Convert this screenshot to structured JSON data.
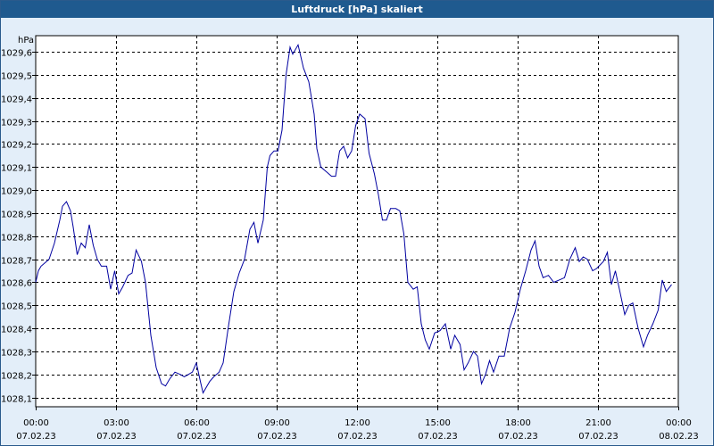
{
  "window": {
    "title": "Luftdruck [hPa] skaliert"
  },
  "colors": {
    "line": "#0000a0",
    "grid": "#000000",
    "plot_bg": "#ffffff",
    "titlebar": "#1f5a8f",
    "background": "#e3eef9"
  },
  "chart_data": {
    "type": "line",
    "title": "Luftdruck [hPa] skaliert",
    "ylabel": "hPa",
    "xlabel": "",
    "ylim": [
      1028.06,
      1029.67
    ],
    "yticks": [
      1028.1,
      1028.2,
      1028.3,
      1028.4,
      1028.5,
      1028.6,
      1028.7,
      1028.8,
      1028.9,
      1029.0,
      1029.1,
      1029.2,
      1029.3,
      1029.4,
      1029.5,
      1029.6
    ],
    "ytick_labels": [
      "1028,1",
      "1028,2",
      "1028,3",
      "1028,4",
      "1028,5",
      "1028,6",
      "1028,7",
      "1028,8",
      "1028,9",
      "1029,0",
      "1029,1",
      "1029,2",
      "1029,3",
      "1029,4",
      "1029,5",
      "1029,6"
    ],
    "xlim_hours": [
      0,
      24
    ],
    "xticks_hours": [
      0,
      3,
      6,
      9,
      12,
      15,
      18,
      21,
      24
    ],
    "xtick_labels": [
      [
        "00:00",
        "07.02.23"
      ],
      [
        "03:00",
        "07.02.23"
      ],
      [
        "06:00",
        "07.02.23"
      ],
      [
        "09:00",
        "07.02.23"
      ],
      [
        "12:00",
        "07.02.23"
      ],
      [
        "15:00",
        "07.02.23"
      ],
      [
        "18:00",
        "07.02.23"
      ],
      [
        "21:00",
        "07.02.23"
      ],
      [
        "00:00",
        "08.02.23"
      ]
    ],
    "grid": true,
    "legend": "none",
    "series": [
      {
        "points": [
          [
            0.0,
            1028.6
          ],
          [
            0.1,
            1028.65
          ],
          [
            0.2,
            1028.67
          ],
          [
            0.4,
            1028.69
          ],
          [
            0.5,
            1028.7
          ],
          [
            0.7,
            1028.77
          ],
          [
            0.9,
            1028.87
          ],
          [
            1.0,
            1028.93
          ],
          [
            1.15,
            1028.95
          ],
          [
            1.3,
            1028.91
          ],
          [
            1.4,
            1028.84
          ],
          [
            1.55,
            1028.72
          ],
          [
            1.7,
            1028.77
          ],
          [
            1.85,
            1028.75
          ],
          [
            2.0,
            1028.85
          ],
          [
            2.15,
            1028.76
          ],
          [
            2.3,
            1028.7
          ],
          [
            2.45,
            1028.67
          ],
          [
            2.65,
            1028.67
          ],
          [
            2.8,
            1028.57
          ],
          [
            2.95,
            1028.65
          ],
          [
            3.1,
            1028.55
          ],
          [
            3.25,
            1028.58
          ],
          [
            3.45,
            1028.63
          ],
          [
            3.6,
            1028.64
          ],
          [
            3.75,
            1028.74
          ],
          [
            3.95,
            1028.69
          ],
          [
            4.1,
            1028.6
          ],
          [
            4.3,
            1028.37
          ],
          [
            4.5,
            1028.23
          ],
          [
            4.7,
            1028.16
          ],
          [
            4.85,
            1028.15
          ],
          [
            5.0,
            1028.18
          ],
          [
            5.2,
            1028.21
          ],
          [
            5.4,
            1028.2
          ],
          [
            5.55,
            1028.19
          ],
          [
            5.7,
            1028.2
          ],
          [
            5.85,
            1028.21
          ],
          [
            6.0,
            1028.25
          ],
          [
            6.15,
            1028.17
          ],
          [
            6.25,
            1028.12
          ],
          [
            6.35,
            1028.14
          ],
          [
            6.5,
            1028.17
          ],
          [
            6.65,
            1028.19
          ],
          [
            6.85,
            1028.21
          ],
          [
            7.0,
            1028.25
          ],
          [
            7.2,
            1028.41
          ],
          [
            7.4,
            1028.56
          ],
          [
            7.6,
            1028.64
          ],
          [
            7.8,
            1028.7
          ],
          [
            8.0,
            1028.83
          ],
          [
            8.15,
            1028.86
          ],
          [
            8.3,
            1028.77
          ],
          [
            8.5,
            1028.87
          ],
          [
            8.65,
            1029.1
          ],
          [
            8.75,
            1029.15
          ],
          [
            8.9,
            1029.17
          ],
          [
            9.05,
            1029.17
          ],
          [
            9.2,
            1029.26
          ],
          [
            9.35,
            1029.5
          ],
          [
            9.5,
            1029.62
          ],
          [
            9.6,
            1029.59
          ],
          [
            9.8,
            1029.63
          ],
          [
            10.0,
            1029.53
          ],
          [
            10.2,
            1029.47
          ],
          [
            10.4,
            1029.33
          ],
          [
            10.5,
            1029.18
          ],
          [
            10.65,
            1029.1
          ],
          [
            10.85,
            1029.08
          ],
          [
            11.05,
            1029.06
          ],
          [
            11.2,
            1029.06
          ],
          [
            11.35,
            1029.17
          ],
          [
            11.5,
            1029.19
          ],
          [
            11.65,
            1029.14
          ],
          [
            11.8,
            1029.17
          ],
          [
            11.95,
            1029.28
          ],
          [
            12.1,
            1029.33
          ],
          [
            12.3,
            1029.31
          ],
          [
            12.45,
            1029.16
          ],
          [
            12.65,
            1029.07
          ],
          [
            12.8,
            1028.98
          ],
          [
            12.95,
            1028.87
          ],
          [
            13.1,
            1028.87
          ],
          [
            13.25,
            1028.92
          ],
          [
            13.45,
            1028.92
          ],
          [
            13.6,
            1028.91
          ],
          [
            13.75,
            1028.81
          ],
          [
            13.9,
            1028.6
          ],
          [
            14.1,
            1028.57
          ],
          [
            14.25,
            1028.58
          ],
          [
            14.4,
            1028.42
          ],
          [
            14.55,
            1028.35
          ],
          [
            14.7,
            1028.31
          ],
          [
            14.9,
            1028.38
          ],
          [
            15.1,
            1028.39
          ],
          [
            15.3,
            1028.42
          ],
          [
            15.5,
            1028.31
          ],
          [
            15.65,
            1028.37
          ],
          [
            15.85,
            1028.33
          ],
          [
            16.0,
            1028.22
          ],
          [
            16.15,
            1028.25
          ],
          [
            16.35,
            1028.3
          ],
          [
            16.5,
            1028.28
          ],
          [
            16.65,
            1028.16
          ],
          [
            16.8,
            1028.2
          ],
          [
            16.95,
            1028.26
          ],
          [
            17.1,
            1028.21
          ],
          [
            17.3,
            1028.28
          ],
          [
            17.5,
            1028.28
          ],
          [
            17.7,
            1028.4
          ],
          [
            17.9,
            1028.47
          ],
          [
            18.1,
            1028.57
          ],
          [
            18.3,
            1028.65
          ],
          [
            18.5,
            1028.74
          ],
          [
            18.65,
            1028.78
          ],
          [
            18.8,
            1028.67
          ],
          [
            18.95,
            1028.62
          ],
          [
            19.15,
            1028.63
          ],
          [
            19.35,
            1028.6
          ],
          [
            19.55,
            1028.61
          ],
          [
            19.75,
            1028.62
          ],
          [
            19.95,
            1028.7
          ],
          [
            20.15,
            1028.75
          ],
          [
            20.3,
            1028.69
          ],
          [
            20.45,
            1028.71
          ],
          [
            20.6,
            1028.7
          ],
          [
            20.8,
            1028.65
          ],
          [
            20.95,
            1028.66
          ],
          [
            21.2,
            1028.69
          ],
          [
            21.35,
            1028.73
          ],
          [
            21.5,
            1028.59
          ],
          [
            21.65,
            1028.65
          ],
          [
            21.8,
            1028.57
          ],
          [
            22.0,
            1028.46
          ],
          [
            22.15,
            1028.5
          ],
          [
            22.3,
            1028.51
          ],
          [
            22.5,
            1028.4
          ],
          [
            22.7,
            1028.32
          ],
          [
            22.85,
            1028.37
          ],
          [
            23.05,
            1028.42
          ],
          [
            23.25,
            1028.48
          ],
          [
            23.4,
            1028.61
          ],
          [
            23.55,
            1028.56
          ],
          [
            23.75,
            1028.59
          ]
        ]
      }
    ]
  }
}
